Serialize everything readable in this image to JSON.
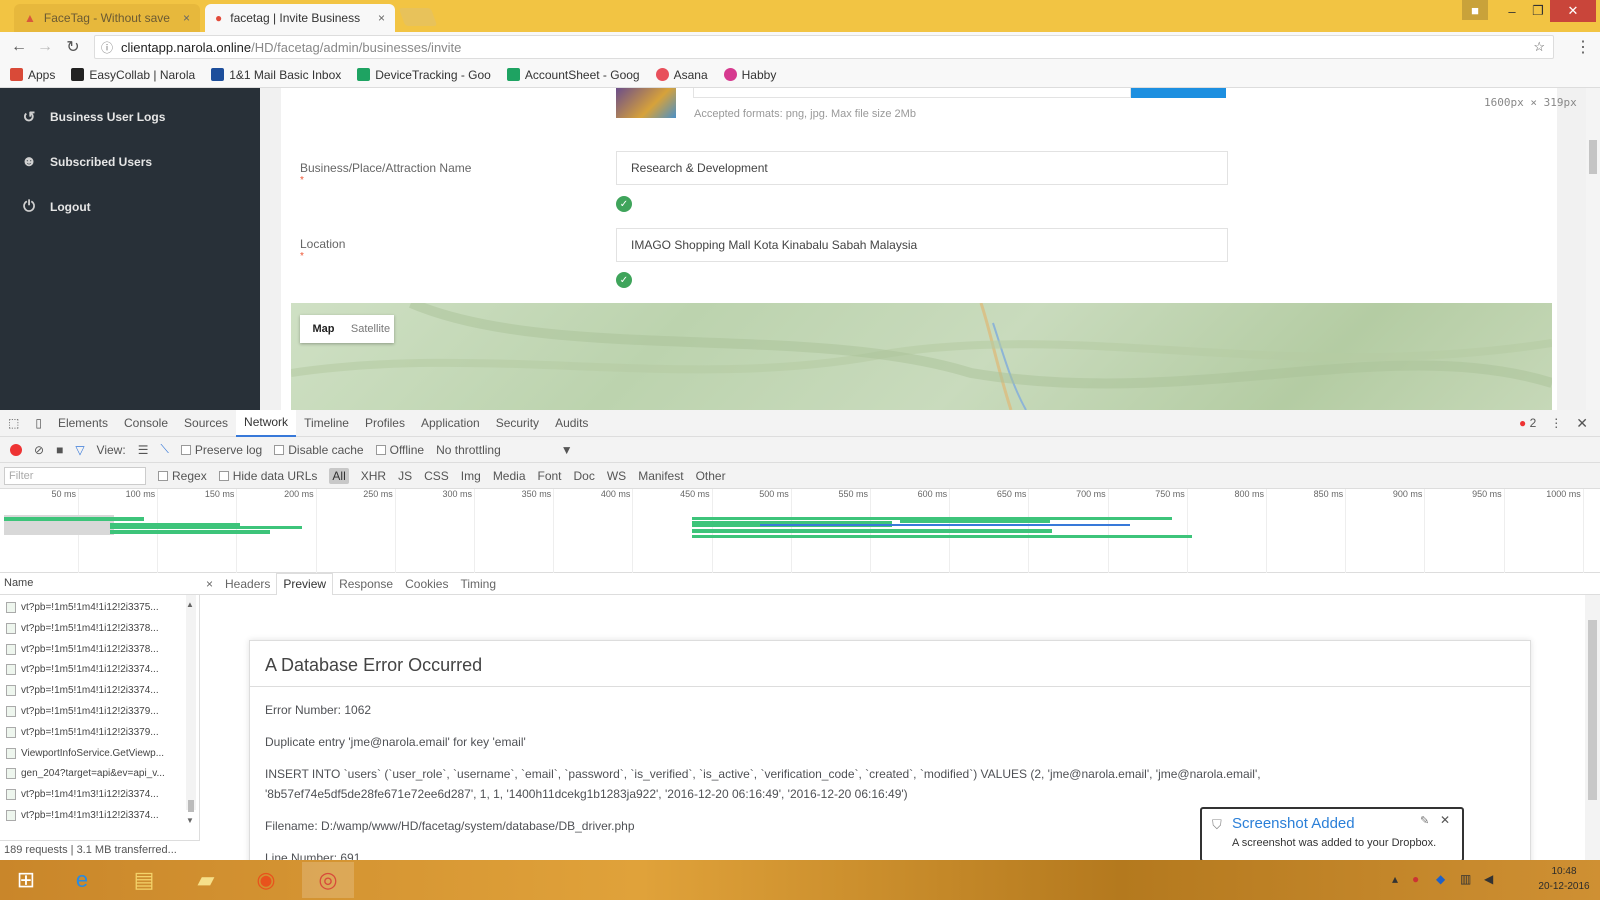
{
  "browser": {
    "tabs": [
      {
        "label": "FaceTag - Without save"
      },
      {
        "label": "facetag | Invite Business"
      }
    ],
    "url_host": "clientapp.narola.online",
    "url_path": "/HD/facetag/admin/businesses/invite",
    "bookmarks": [
      {
        "label": "Apps",
        "color": "#d94a38"
      },
      {
        "label": "EasyCollab | Narola",
        "color": "#222222"
      },
      {
        "label": "1&1 Mail Basic Inbox",
        "color": "#1d4e9b"
      },
      {
        "label": "DeviceTracking - Goo",
        "color": "#1ea362"
      },
      {
        "label": "AccountSheet - Goog",
        "color": "#1ea362"
      },
      {
        "label": "Asana",
        "color": "#e8505b"
      },
      {
        "label": "Habby",
        "color": "#d63a8f"
      }
    ]
  },
  "sidebar": {
    "items": [
      {
        "label": "Business User Logs",
        "icon": "history-icon"
      },
      {
        "label": "Subscribed Users",
        "icon": "user-icon"
      },
      {
        "label": "Logout",
        "icon": "power-icon"
      }
    ]
  },
  "form": {
    "upload_hint": "Accepted formats: png, jpg. Max file size 2Mb",
    "name_label": "Business/Place/Attraction Name",
    "name_value": "Research & Development",
    "location_label": "Location",
    "location_value": "IMAGO Shopping Mall Kota Kinabalu Sabah Malaysia",
    "required_mark": "*",
    "map_types": [
      "Map",
      "Satellite"
    ],
    "dimensions_readout": "1600px × 319px"
  },
  "devtools": {
    "tabs": [
      "Elements",
      "Console",
      "Sources",
      "Network",
      "Timeline",
      "Profiles",
      "Application",
      "Security",
      "Audits"
    ],
    "error_count": "2",
    "view_label": "View:",
    "preserve_log": "Preserve log",
    "disable_cache": "Disable cache",
    "offline": "Offline",
    "throttling": "No throttling",
    "filter_placeholder": "Filter",
    "regex": "Regex",
    "hide_data_urls": "Hide data URLs",
    "types": [
      "All",
      "XHR",
      "JS",
      "CSS",
      "Img",
      "Media",
      "Font",
      "Doc",
      "WS",
      "Manifest",
      "Other"
    ],
    "ticks": [
      "50 ms",
      "100 ms",
      "150 ms",
      "200 ms",
      "250 ms",
      "300 ms",
      "350 ms",
      "400 ms",
      "450 ms",
      "500 ms",
      "550 ms",
      "600 ms",
      "650 ms",
      "700 ms",
      "750 ms",
      "800 ms",
      "850 ms",
      "900 ms",
      "950 ms",
      "1000 ms"
    ],
    "name_header": "Name",
    "requests": [
      "vt?pb=!1m5!1m4!1i12!2i3375...",
      "vt?pb=!1m5!1m4!1i12!2i3378...",
      "vt?pb=!1m5!1m4!1i12!2i3378...",
      "vt?pb=!1m5!1m4!1i12!2i3374...",
      "vt?pb=!1m5!1m4!1i12!2i3374...",
      "vt?pb=!1m5!1m4!1i12!2i3379...",
      "vt?pb=!1m5!1m4!1i12!2i3379...",
      "ViewportInfoService.GetViewp...",
      "gen_204?target=api&ev=api_v...",
      "vt?pb=!1m4!1m3!1i12!2i3374...",
      "vt?pb=!1m4!1m3!1i12!2i3374..."
    ],
    "footer": "189 requests | 3.1 MB transferred...",
    "detail_tabs": [
      "Headers",
      "Preview",
      "Response",
      "Cookies",
      "Timing"
    ],
    "close_glyph": "×"
  },
  "error": {
    "title": "A Database Error Occurred",
    "number": "Error Number: 1062",
    "message": "Duplicate entry 'jme@narola.email' for key 'email'",
    "query": "INSERT INTO `users` (`user_role`, `username`, `email`, `password`, `is_verified`, `is_active`, `verification_code`, `created`, `modified`) VALUES (2, 'jme@narola.email', 'jme@narola.email', '8b57ef74e5df5de28fe671e72ee6d287', 1, 1, '1400h11dcekg1b1283ja922', '2016-12-20 06:16:49', '2016-12-20 06:16:49')",
    "filename": "Filename: D:/wamp/www/HD/facetag/system/database/DB_driver.php",
    "line": "Line Number: 691"
  },
  "notification": {
    "title": "Screenshot Added",
    "body": "A screenshot was added to your Dropbox."
  },
  "taskbar": {
    "clock_time": "10:48",
    "clock_date": "20-12-2016"
  }
}
